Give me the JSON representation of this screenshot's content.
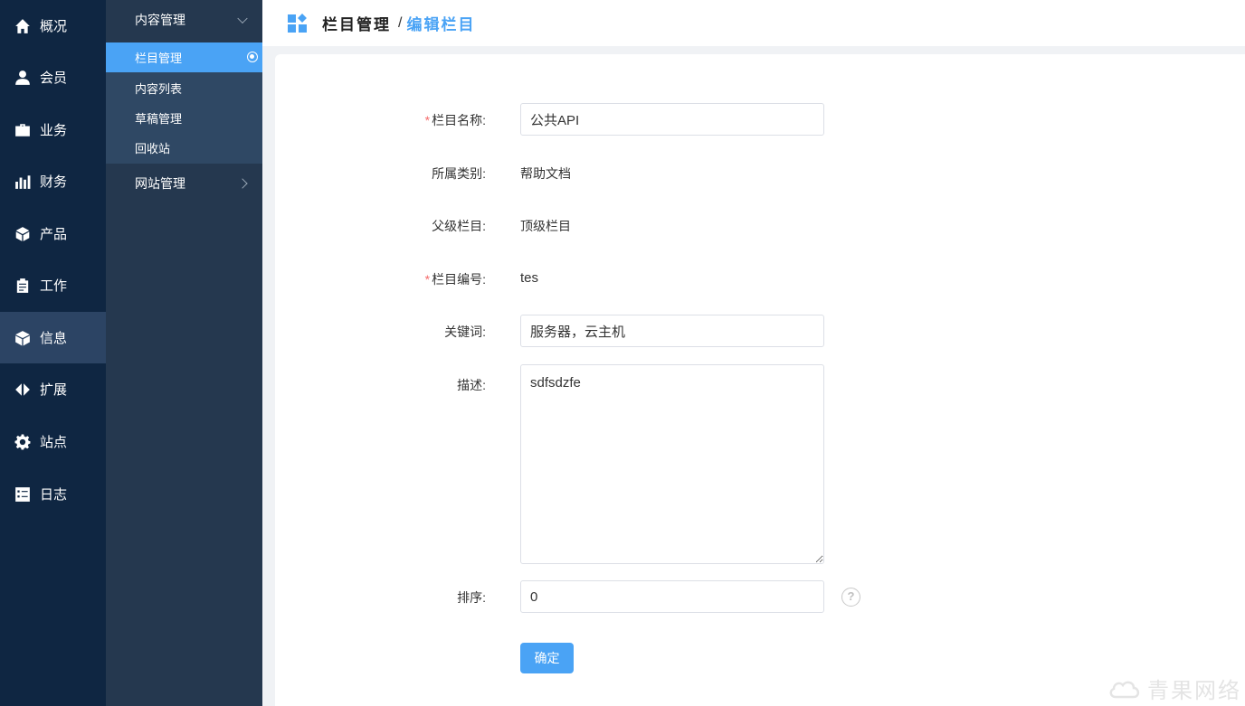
{
  "main_nav": [
    {
      "label": "概况",
      "icon": "home-icon"
    },
    {
      "label": "会员",
      "icon": "user-icon"
    },
    {
      "label": "业务",
      "icon": "briefcase-icon"
    },
    {
      "label": "财务",
      "icon": "bar-chart-icon"
    },
    {
      "label": "产品",
      "icon": "cube-icon"
    },
    {
      "label": "工作",
      "icon": "clipboard-icon"
    },
    {
      "label": "信息",
      "icon": "box-icon",
      "active": true
    },
    {
      "label": "扩展",
      "icon": "expand-arrows-icon"
    },
    {
      "label": "站点",
      "icon": "gear-icon"
    },
    {
      "label": "日志",
      "icon": "checklist-icon"
    }
  ],
  "sub_nav": {
    "content_group": "内容管理",
    "items": [
      "栏目管理",
      "内容列表",
      "草稿管理",
      "回收站"
    ],
    "active_item": "栏目管理",
    "site_group": "网站管理"
  },
  "header": {
    "crumb_parent": "栏目管理",
    "separator": "/",
    "crumb_current": "编辑栏目"
  },
  "form": {
    "name_label": "栏目名称:",
    "name_value": "公共API",
    "category_label": "所属类别:",
    "category_value": "帮助文档",
    "parent_label": "父级栏目:",
    "parent_value": "顶级栏目",
    "code_label": "栏目编号:",
    "code_value": "tes",
    "keywords_label": "关键词:",
    "keywords_value": "服务器，云主机",
    "desc_label": "描述:",
    "desc_value": "sdfsdzfe",
    "sort_label": "排序:",
    "sort_value": "0",
    "help_glyph": "?",
    "required_mark": "*",
    "submit_label": "确定"
  },
  "watermark": "青果网络",
  "colors": {
    "accent": "#4aa3f5",
    "sidebar_main": "#0f2642",
    "sidebar_sub": "#25384f",
    "required": "#f56c6c"
  }
}
